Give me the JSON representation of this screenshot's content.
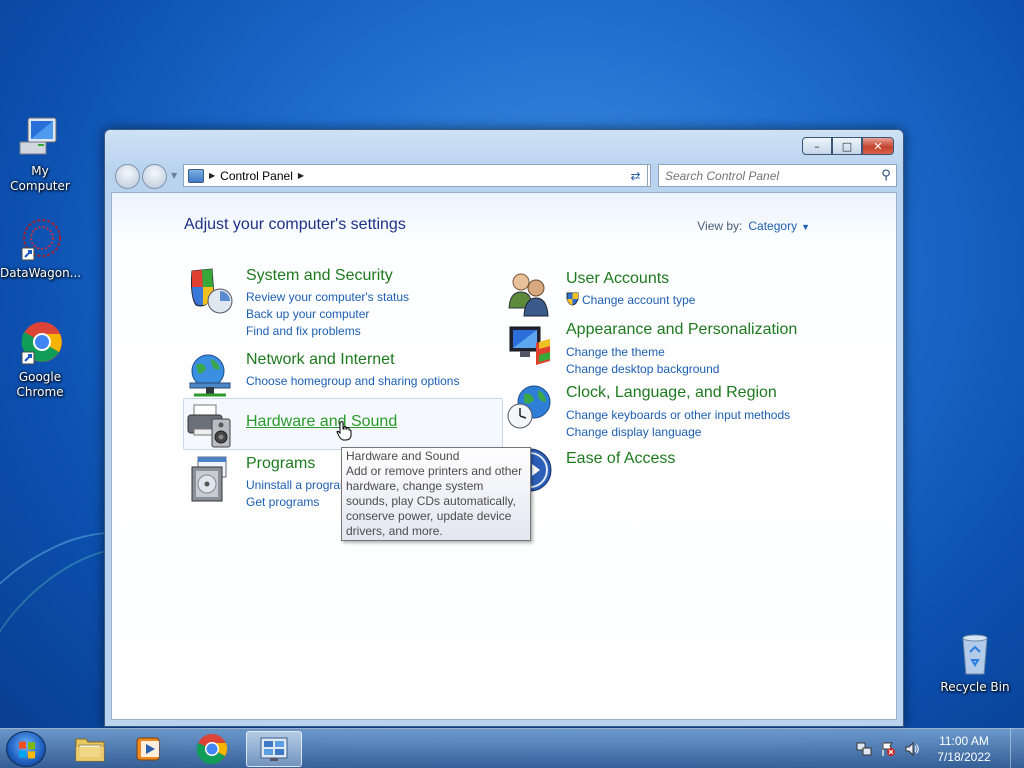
{
  "desktop": {
    "icons": [
      {
        "label": "My Computer"
      },
      {
        "label": "DataWagon..."
      },
      {
        "label": "Google Chrome"
      },
      {
        "label": "Recycle Bin"
      }
    ]
  },
  "window": {
    "address": {
      "crumbs": [
        "Control Panel"
      ]
    },
    "search": {
      "placeholder": "Search Control Panel"
    },
    "heading": "Adjust your computer's settings",
    "view_by": {
      "label": "View by:",
      "value": "Category"
    },
    "categories": [
      {
        "title": "System and Security",
        "icon": "shield-icon",
        "links": [
          "Review your computer's status",
          "Back up your computer",
          "Find and fix problems"
        ]
      },
      {
        "title": "Network and Internet",
        "icon": "globe-network-icon",
        "links": [
          "Choose homegroup and sharing options"
        ]
      },
      {
        "title": "Hardware and Sound",
        "icon": "printer-icon",
        "links": []
      },
      {
        "title": "Programs",
        "icon": "programs-icon",
        "links": [
          "Uninstall a program",
          "Get programs"
        ]
      },
      {
        "title": "User Accounts",
        "icon": "users-icon",
        "links": [
          "Change account type"
        ]
      },
      {
        "title": "Appearance and Personalization",
        "icon": "monitor-paint-icon",
        "links": [
          "Change the theme",
          "Change desktop background"
        ]
      },
      {
        "title": "Clock, Language, and Region",
        "icon": "clock-globe-icon",
        "links": [
          "Change keyboards or other input methods",
          "Change display language"
        ]
      },
      {
        "title": "Ease of Access",
        "icon": "ease-of-access-icon",
        "links": []
      }
    ],
    "tooltip": {
      "title": "Hardware and Sound",
      "body": "Add or remove printers and other hardware, change system sounds, play CDs automatically, conserve power, update device drivers, and more."
    }
  },
  "taskbar": {
    "clock": {
      "time": "11:00 AM",
      "date": "7/18/2022"
    }
  },
  "colors": {
    "link": "#1c5fb3",
    "category_title": "#1e7a1e",
    "heading": "#1e3287"
  }
}
